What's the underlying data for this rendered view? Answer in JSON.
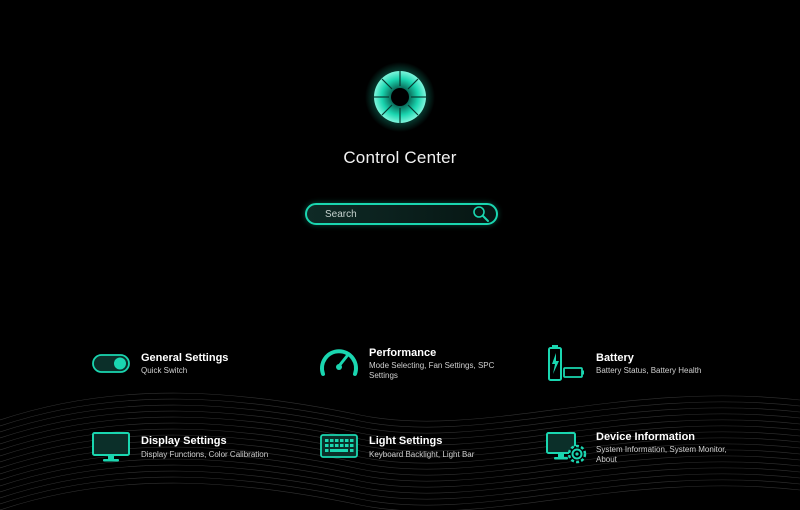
{
  "app": {
    "title": "Control Center"
  },
  "search": {
    "placeholder": "Search"
  },
  "tiles": [
    {
      "title": "General Settings",
      "desc": "Quick Switch"
    },
    {
      "title": "Performance",
      "desc": "Mode Selecting, Fan Settings, SPC Settings"
    },
    {
      "title": "Battery",
      "desc": "Battery Status, Battery Health"
    },
    {
      "title": "Display Settings",
      "desc": "Display Functions, Color Calibration"
    },
    {
      "title": "Light Settings",
      "desc": "Keyboard Backlight, Light Bar"
    },
    {
      "title": "Device Information",
      "desc": "System Information, System Monitor, About"
    }
  ],
  "icons": {
    "logo": "control-center-logo",
    "search": "search-icon",
    "tiles": [
      "toggle-switch-icon",
      "speedometer-icon",
      "battery-charging-icon",
      "monitor-icon",
      "keyboard-icon",
      "device-settings-icon"
    ]
  },
  "colors": {
    "accent": "#1ad6b0",
    "background": "#000000",
    "text": "#ffffff",
    "subtext": "#cfcfcf"
  }
}
